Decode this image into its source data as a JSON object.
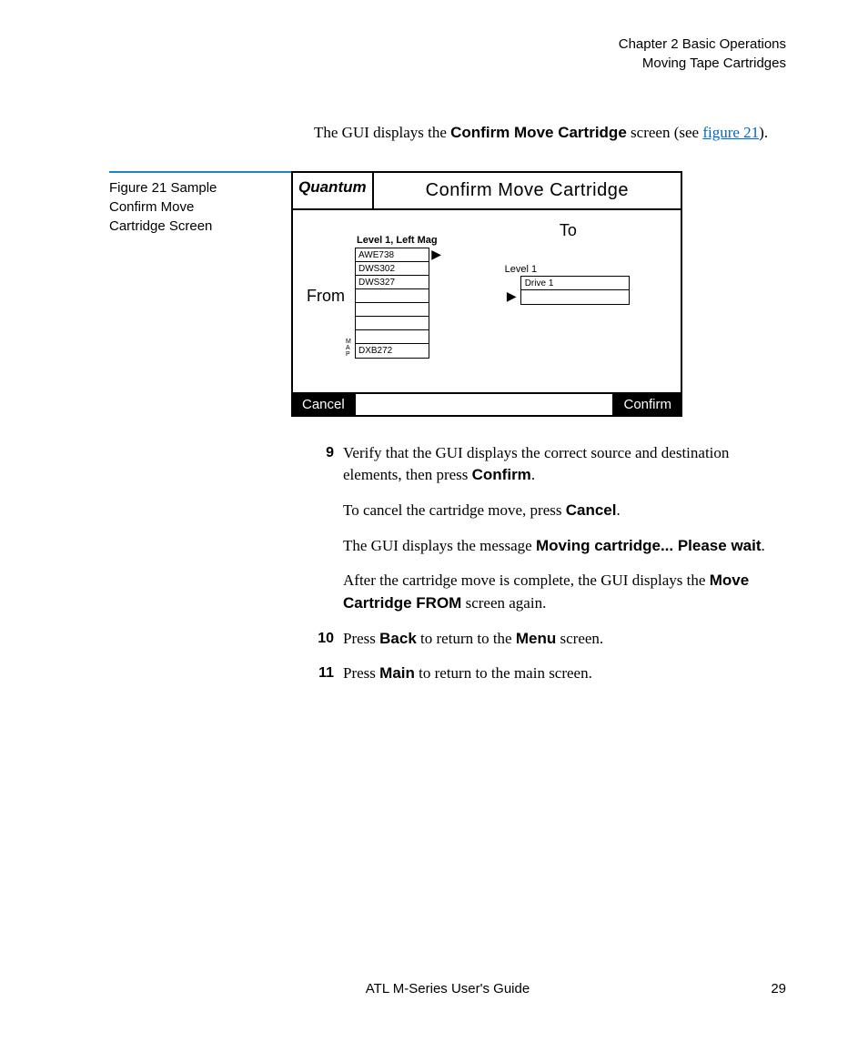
{
  "header": {
    "chapter": "Chapter 2  Basic Operations",
    "section": "Moving Tape Cartridges"
  },
  "intro": {
    "pre": "The GUI displays the ",
    "bold": "Confirm Move Cartridge",
    "post": " screen (see ",
    "link": "figure 21",
    "close": ")."
  },
  "figure": {
    "caption_line1": "Figure 21  Sample",
    "caption_line2": "Confirm Move",
    "caption_line3": "Cartridge Screen"
  },
  "gui": {
    "logo": "Quantum",
    "title": "Confirm Move Cartridge",
    "from_label": "From",
    "from_header": "Level 1, Left Mag",
    "from_slots": [
      "AWE738",
      "DWS302",
      "DWS327",
      "",
      "",
      "",
      "",
      "DXB272"
    ],
    "map": "MAP",
    "to_label": "To",
    "to_header": "Level 1",
    "to_slots": [
      "Drive 1",
      ""
    ],
    "cancel": "Cancel",
    "confirm": "Confirm"
  },
  "steps": {
    "s9": {
      "num": "9",
      "p1a": "Verify that the GUI displays the correct source and destination elements, then press ",
      "p1b": "Confirm",
      "p1c": ".",
      "p2a": "To cancel the cartridge move, press ",
      "p2b": "Cancel",
      "p2c": ".",
      "p3a": "The GUI displays the message ",
      "p3b": "Moving cartridge... Please wait",
      "p3c": ".",
      "p4a": "After the cartridge move is complete, the GUI displays the ",
      "p4b": "Move Cartridge FROM",
      "p4c": " screen again."
    },
    "s10": {
      "num": "10",
      "a": "Press ",
      "b": "Back",
      "c": " to return to the ",
      "d": "Menu",
      "e": " screen."
    },
    "s11": {
      "num": "11",
      "a": "Press ",
      "b": "Main",
      "c": " to return to the main screen."
    }
  },
  "footer": {
    "title": "ATL M-Series User's Guide",
    "page": "29"
  }
}
